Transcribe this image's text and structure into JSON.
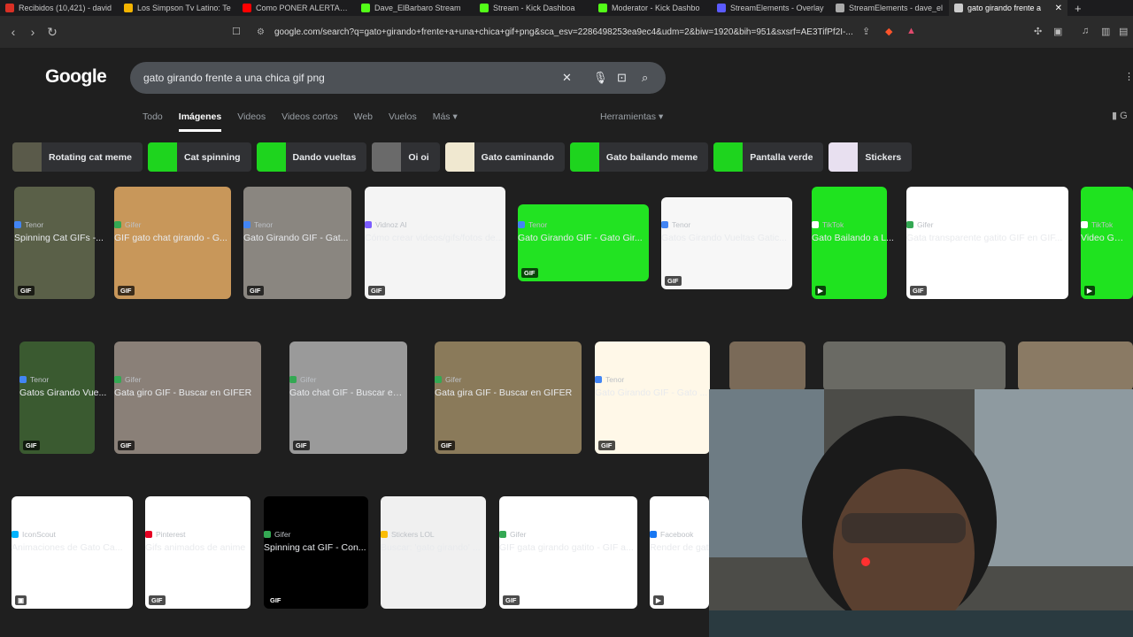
{
  "tabs": [
    {
      "title": "Recibidos (10,421) - david",
      "color": "#d93025"
    },
    {
      "title": "Los Simpson Tv Latino: Te",
      "color": "#f4b400"
    },
    {
      "title": "Como PONER ALERTAS de",
      "color": "#ff0000"
    },
    {
      "title": "Dave_ElBarbaro Stream",
      "color": "#53fc18"
    },
    {
      "title": "Stream - Kick Dashboa",
      "color": "#53fc18"
    },
    {
      "title": "Moderator - Kick Dashbo",
      "color": "#53fc18"
    },
    {
      "title": "StreamElements - Overlay",
      "color": "#5b5bff"
    },
    {
      "title": "StreamElements - dave_el",
      "color": "#aaaaaa"
    },
    {
      "title": "gato girando frente a",
      "color": "#cccccc"
    }
  ],
  "new_tab": "+",
  "url": "google.com/search?q=gato+girando+frente+a+una+chica+gif+png&sca_esv=2286498253ea9ec4&udm=2&biw=1920&bih=951&sxsrf=AE3TifPf2I-...",
  "logo": "Google",
  "search": {
    "query": "gato girando frente a una chica gif png"
  },
  "menu": {
    "all": "Todo",
    "images": "Imágenes",
    "videos": "Videos",
    "short_videos": "Videos cortos",
    "web": "Web",
    "flights": "Vuelos",
    "more": "Más ▾",
    "tools": "Herramientas ▾"
  },
  "chips": [
    {
      "label": "Rotating cat meme",
      "color": "#5a5a4a"
    },
    {
      "label": "Cat spinning",
      "color": "#1ed41e"
    },
    {
      "label": "Dando vueltas",
      "color": "#1ed41e"
    },
    {
      "label": "Oi oi",
      "color": "#6a6a6a"
    },
    {
      "label": "Gato caminando",
      "color": "#f0e8d0"
    },
    {
      "label": "Gato bailando meme",
      "color": "#1ed41e"
    },
    {
      "label": "Pantalla verde",
      "color": "#1ed41e"
    },
    {
      "label": "Stickers",
      "color": "#e8e0f0"
    }
  ],
  "results": [
    {
      "src": "Tenor",
      "cap": "Spinning Cat GIFs -...",
      "badge": "GIF",
      "color": "#5a6048",
      "srccolor": "#4285f4"
    },
    {
      "src": "Gifer",
      "cap": "GIF gato chat girando - G...",
      "badge": "GIF",
      "color": "#c8975a",
      "srccolor": "#34a853"
    },
    {
      "src": "Tenor",
      "cap": "Gato Girando GIF - Gat...",
      "badge": "GIF",
      "color": "#8a8680",
      "srccolor": "#4285f4"
    },
    {
      "src": "Vidnoz AI",
      "cap": "Cómo crear videos/gifs/fotos de...",
      "badge": "GIF",
      "color": "#f4f4f4",
      "srccolor": "#7b5cff"
    },
    {
      "src": "Tenor",
      "cap": "Gato Girando GIF - Gato Gir...",
      "badge": "GIF",
      "color": "#22e322",
      "srccolor": "#4285f4"
    },
    {
      "src": "Tenor",
      "cap": "Gatos Girando Vueltas Gatic...",
      "badge": "GIF",
      "color": "#f7f7f7",
      "srccolor": "#4285f4"
    },
    {
      "src": "TikTok",
      "cap": "Gato Bailando a L...",
      "badge": "▶",
      "color": "#1fe31f",
      "srccolor": "#ffffff"
    },
    {
      "src": "Gifer",
      "cap": "Gata transparente gatito GIF en GIF...",
      "badge": "GIF",
      "color": "#ffffff",
      "srccolor": "#34a853"
    },
    {
      "src": "TikTok",
      "cap": "Video Gato D",
      "badge": "▶",
      "color": "#1fe31f",
      "srccolor": "#ffffff"
    },
    {
      "src": "Tenor",
      "cap": "Gatos Girando Vue...",
      "badge": "GIF",
      "color": "#3a5a30",
      "srccolor": "#4285f4"
    },
    {
      "src": "Gifer",
      "cap": "Gata giro GIF - Buscar en GIFER",
      "badge": "GIF",
      "color": "#8a8078",
      "srccolor": "#34a853"
    },
    {
      "src": "Gifer",
      "cap": "Gato chat GIF - Buscar en GIFER",
      "badge": "GIF",
      "color": "#9a9a9a",
      "srccolor": "#34a853"
    },
    {
      "src": "Gifer",
      "cap": "Gata gira GIF - Buscar en GIFER",
      "badge": "GIF",
      "color": "#8a7a5a",
      "srccolor": "#34a853"
    },
    {
      "src": "Tenor",
      "cap": "Gato Girando GIF - Gato ...",
      "badge": "GIF",
      "color": "#fff8e8",
      "srccolor": "#4285f4"
    },
    {
      "src": "",
      "cap": "",
      "badge": "",
      "color": "#7a6a58",
      "srccolor": "#4285f4"
    },
    {
      "src": "",
      "cap": "",
      "badge": "",
      "color": "#6a6a64",
      "srccolor": "#4285f4"
    },
    {
      "src": "",
      "cap": "",
      "badge": "",
      "color": "#8a7a64",
      "srccolor": "#4285f4"
    },
    {
      "src": "IconScout",
      "cap": "Animaciones de Gato Ca...",
      "badge": "▣",
      "color": "#ffffff",
      "srccolor": "#00b3ff"
    },
    {
      "src": "Pinterest",
      "cap": "Gifs animados de anime",
      "badge": "GIF",
      "color": "#ffffff",
      "srccolor": "#e60023"
    },
    {
      "src": "Gifer",
      "cap": "Spinning cat GIF - Con...",
      "badge": "GIF",
      "color": "#000000",
      "srccolor": "#34a853"
    },
    {
      "src": "Stickers LOL",
      "cap": "Buscar: 'gato girando' ...",
      "badge": "",
      "color": "#f0f0f0",
      "srccolor": "#fbbc04"
    },
    {
      "src": "Gifer",
      "cap": "GIF gata girando gatito - GIF a...",
      "badge": "GIF",
      "color": "#ffffff",
      "srccolor": "#34a853"
    },
    {
      "src": "Facebook",
      "cap": "Render de gat",
      "badge": "▶",
      "color": "#ffffff",
      "srccolor": "#1877f2"
    }
  ]
}
